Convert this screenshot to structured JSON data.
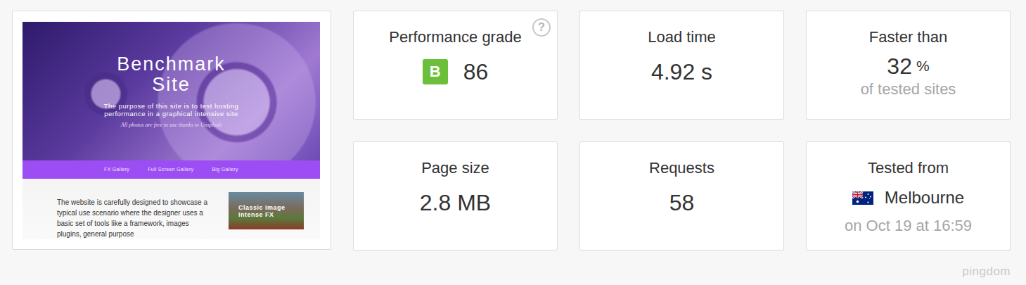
{
  "preview": {
    "title": "Benchmark Site",
    "subtitle": "The purpose of this site is to test hosting performance in a graphical intensive site",
    "credit": "All photos are free to use thanks to Unsplash",
    "nav": [
      "FX Gallery",
      "Full Screen Gallery",
      "Big Gallery"
    ],
    "body": "The website is carefully designed to showcase a typical use scenario where the designer uses a basic set of tools like a framework, images plugins, general purpose",
    "thumbnail_caption": "Classic Image Intense FX"
  },
  "metrics": [
    {
      "kind": "grade",
      "label": "Performance grade",
      "grade": "B",
      "value": "86",
      "help": "?"
    },
    {
      "kind": "value",
      "label": "Load time",
      "value": "4.92 s"
    },
    {
      "kind": "percent",
      "label": "Faster than",
      "value": "32",
      "unit": "%",
      "note": "of tested sites"
    },
    {
      "kind": "value",
      "label": "Page size",
      "value": "2.8 MB"
    },
    {
      "kind": "value",
      "label": "Requests",
      "value": "58"
    },
    {
      "kind": "location",
      "label": "Tested from",
      "value": "Melbourne",
      "note": "on Oct 19 at 16:59"
    }
  ],
  "brand": "pingdom"
}
